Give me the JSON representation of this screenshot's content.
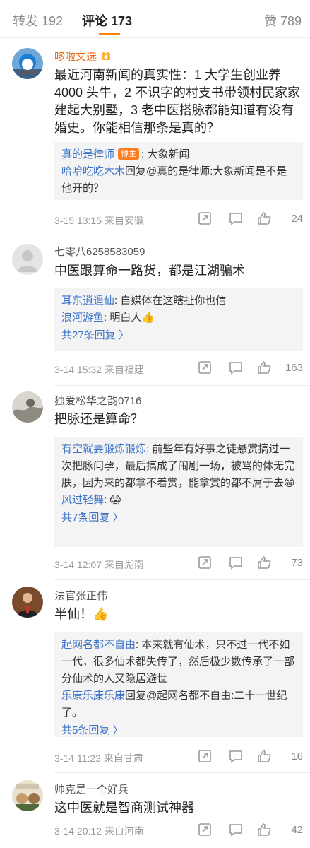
{
  "tabs": {
    "repost": "转发 192",
    "comments": "评论 173",
    "likes": "赞 789"
  },
  "comments": [
    {
      "author": "哆啦文选",
      "text": "最近河南新闻的真实性：1 大学生创业养4000 头牛，2 不识字的村支书带领村民家家建起大别墅，3 老中医搭脉都能知道有没有婚史。你能相信那条是真的？",
      "replies": [
        {
          "who": "真的是律师",
          "tag": "博主",
          "text": ": 大象新闻"
        },
        {
          "who": "哈哈吃吃木木",
          "text": "回复@真的是律师:大象新闻是不是他开的？"
        }
      ],
      "time": "3-15 13:15  来自安徽",
      "like_count": "24"
    },
    {
      "author": "七零八6258583059",
      "text": "中医跟算命一路货，都是江湖骗术",
      "replies": [
        {
          "who": "耳东逍遥仙",
          "text": ": 自媒体在这瞎扯你也信"
        },
        {
          "who": "浪河游鱼",
          "text": ": 明白人👍"
        }
      ],
      "more": "共27条回复  〉",
      "time": "3-14 15:32  来自福建",
      "like_count": "163"
    },
    {
      "author": "独爱松华之韵0716",
      "text": "把脉还是算命？",
      "replies": [
        {
          "who": "有空就要锻炼锻炼",
          "text": ": 前些年有好事之徒悬赏搞过一次把脉问孕，最后搞成了闹剧一场，被骂的体无完肤，因为来的都拿不着赏，能拿赏的都不屑于去😁"
        },
        {
          "who": "风过轻舞",
          "text": ": 😱"
        }
      ],
      "more": "共7条回复  〉",
      "time": "3-14 12:07  来自湖南",
      "like_count": "73"
    },
    {
      "author": "法官张正伟",
      "text": "半仙！👍",
      "replies": [
        {
          "who": "起网名都不自由",
          "text": ": 本来就有仙术，只不过一代不如一代，很多仙术都失传了，然后极少数传承了一部分仙术的人又隐居避世"
        },
        {
          "who": "乐康乐康乐康",
          "text": "回复@起网名都不自由:二十一世纪了。"
        }
      ],
      "more": "共5条回复  〉",
      "time": "3-14 11:23  来自甘肃",
      "like_count": "16"
    },
    {
      "author": "帅克是一个好兵",
      "text": "这中医就是智商测试神器",
      "time": "3-14 20:12  来自河南",
      "like_count": "42"
    }
  ],
  "colors": {
    "accent": "#ff8200",
    "link": "#3c73c8",
    "vip_name": "#ec6615"
  },
  "icons": [
    "share-icon",
    "comment-icon",
    "like-icon",
    "chevron-right-icon",
    "medal-icon"
  ]
}
